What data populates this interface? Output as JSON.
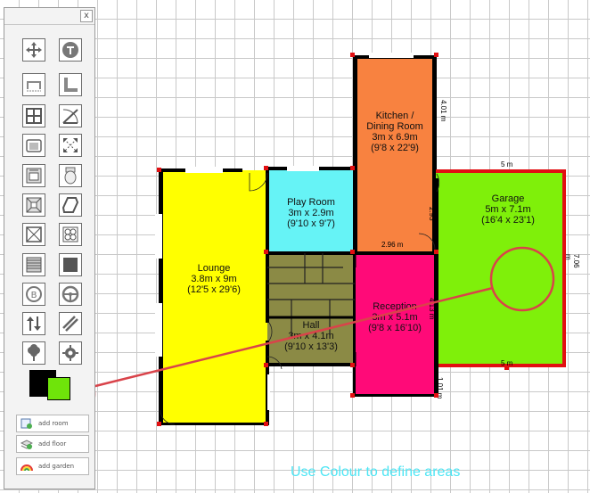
{
  "palette": {
    "close_label": "x",
    "tools": [
      {
        "name": "move-tool-icon"
      },
      {
        "name": "text-tool-icon"
      },
      {
        "name": "wall-tool-icon"
      },
      {
        "name": "corner-wall-icon"
      },
      {
        "name": "window-tool-icon"
      },
      {
        "name": "door-tool-icon"
      },
      {
        "name": "sofa-icon"
      },
      {
        "name": "resize-icon"
      },
      {
        "name": "cooker-icon"
      },
      {
        "name": "toilet-icon"
      },
      {
        "name": "cross-box-icon"
      },
      {
        "name": "bath-icon"
      },
      {
        "name": "box-cross-icon"
      },
      {
        "name": "hob-icon"
      },
      {
        "name": "stairs-icon"
      },
      {
        "name": "solid-square-icon"
      },
      {
        "name": "boiler-icon"
      },
      {
        "name": "steering-wheel-icon"
      },
      {
        "name": "up-down-arrows-icon"
      },
      {
        "name": "diagonal-lines-icon"
      },
      {
        "name": "tree-icon"
      },
      {
        "name": "gear-icon"
      }
    ],
    "colors": {
      "foreground": "#000000",
      "background": "#6fe40a"
    },
    "buttons": {
      "add_room": "add room",
      "add_floor": "add floor",
      "add_garden": "add garden"
    }
  },
  "plan": {
    "rooms": {
      "lounge": {
        "name": "Lounge",
        "metric": "3.8m x 9m",
        "imperial": "(12'5 x 29'6)",
        "color": "#ffff00"
      },
      "play_room": {
        "name": "Play Room",
        "metric": "3m x 2.9m",
        "imperial": "(9'10 x 9'7)",
        "color": "#66f3f6"
      },
      "kitchen": {
        "name": "Kitchen /",
        "name2": "Dining Room",
        "metric": "3m x 6.9m",
        "imperial": "(9'8 x 22'9)",
        "color": "#f88240"
      },
      "garage": {
        "name": "Garage",
        "metric": "5m x 7.1m",
        "imperial": "(16'4 x 23'1)",
        "color": "#7ff00a"
      },
      "hall": {
        "name": "Hall",
        "metric": "3m x 4.1m",
        "imperial": "(9'10 x 13'3)",
        "color": "#8b8a45"
      },
      "reception": {
        "name": "Reception",
        "metric": "3m x 5.1m",
        "imperial": "(9'8 x 16'10)",
        "color": "#ff0a78"
      }
    },
    "dims": {
      "kitchen_side": "4.01 m",
      "kitchen_bottom": "2.96 m",
      "kitchen_bottom_right": "2.93",
      "garage_top": "5 m",
      "garage_bottom": "5 m",
      "garage_right": "7.06 m",
      "reception_right": "4.13 m",
      "small_right": "1.01 m"
    }
  },
  "caption": "Use Colour to define areas"
}
